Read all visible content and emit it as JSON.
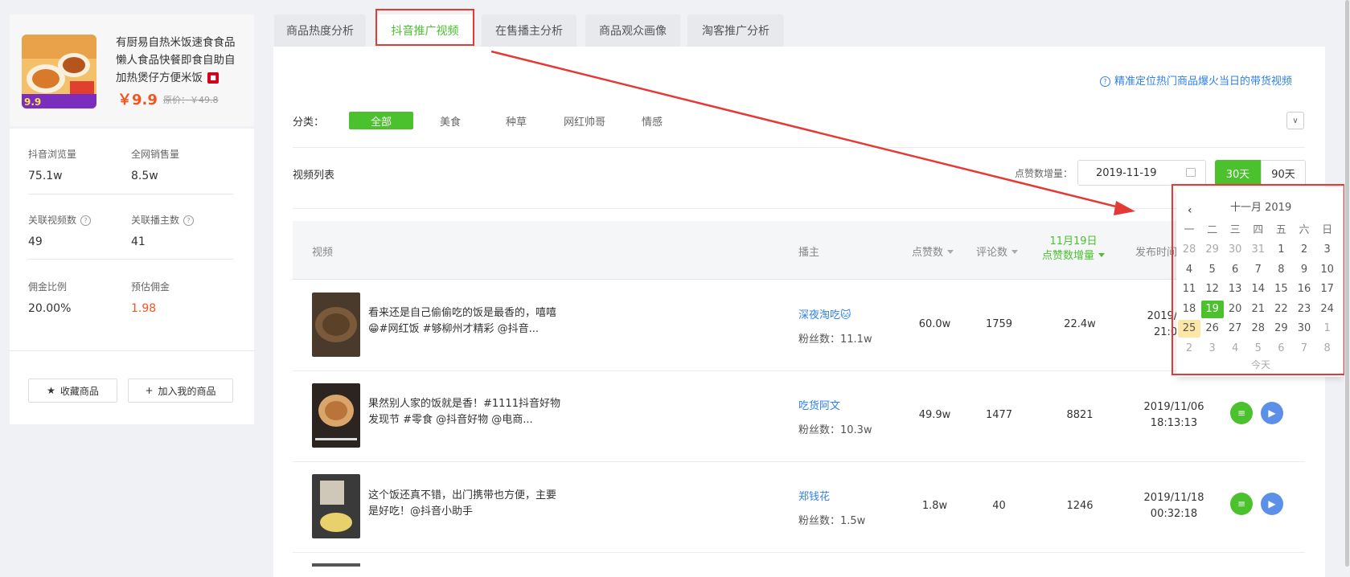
{
  "product": {
    "title": "有厨易自热米饭速食食品懒人食品快餐即食自助自加热煲仔方便米饭",
    "badge": "天猫",
    "price": "￥9.9",
    "orig_price": "原价：￥49.8"
  },
  "stats": [
    {
      "label": "抖音浏览量",
      "value": "75.1w",
      "help": false
    },
    {
      "label": "全网销售量",
      "value": "8.5w",
      "help": false
    },
    {
      "label": "关联视频数",
      "value": "49",
      "help": true
    },
    {
      "label": "关联播主数",
      "value": "41",
      "help": true
    },
    {
      "label": "佣金比例",
      "value": "20.00%",
      "help": false
    },
    {
      "label": "预估佣金",
      "value": "1.98",
      "help": false
    }
  ],
  "actions": {
    "favorite": "收藏商品",
    "add_mine": "加入我的商品"
  },
  "tabs": [
    "商品热度分析",
    "抖音推广视频",
    "在售播主分析",
    "商品观众画像",
    "淘客推广分析"
  ],
  "active_tab": 1,
  "hint_link": "精准定位热门商品爆火当日的带货视频",
  "category": {
    "label": "分类：",
    "items": [
      "全部",
      "美食",
      "种草",
      "网红帅哥",
      "情感"
    ],
    "active": 0
  },
  "list": {
    "title": "视频列表",
    "date_label": "点赞数增量：",
    "date_value": "2019-11-19",
    "ranges": [
      "30天",
      "90天"
    ]
  },
  "columns": {
    "video": "视频",
    "anchor": "播主",
    "likes": "点赞数",
    "comments": "评论数",
    "day_label": "11月19日",
    "day_sub": "点赞数增量",
    "publish": "发布时间"
  },
  "rows": [
    {
      "desc": "看来还是自己偷偷吃的饭是最香的，嘻嘻😁#网红饭 #够柳州才精彩 @抖音...",
      "anchor": "深夜淘吃🐱",
      "fans": "粉丝数：11.1w",
      "likes": "60.0w",
      "comments": "1759",
      "inc": "22.4w",
      "date": "2019/11/0",
      "time": "21:00:0"
    },
    {
      "desc": "果然别人家的饭就是香！#1111抖音好物发现节 #零食 @抖音好物 @电商...",
      "anchor": "吃货阿文",
      "fans": "粉丝数：10.3w",
      "likes": "49.9w",
      "comments": "1477",
      "inc": "8821",
      "date": "2019/11/06",
      "time": "18:13:13"
    },
    {
      "desc": "这个饭还真不错，出门携带也方便，主要是好吃！@抖音小助手",
      "anchor": "郑钱花",
      "fans": "粉丝数：1.5w",
      "likes": "1.8w",
      "comments": "40",
      "inc": "1246",
      "date": "2019/11/18",
      "time": "00:32:18"
    }
  ],
  "calendar": {
    "month": "十一月 2019",
    "weekdays": [
      "一",
      "二",
      "三",
      "四",
      "五",
      "六",
      "日"
    ],
    "days": [
      [
        "28",
        "29",
        "30",
        "31",
        "1",
        "2",
        "3"
      ],
      [
        "4",
        "5",
        "6",
        "7",
        "8",
        "9",
        "10"
      ],
      [
        "11",
        "12",
        "13",
        "14",
        "15",
        "16",
        "17"
      ],
      [
        "18",
        "19",
        "20",
        "21",
        "22",
        "23",
        "24"
      ],
      [
        "25",
        "26",
        "27",
        "28",
        "29",
        "30",
        "1"
      ],
      [
        "2",
        "3",
        "4",
        "5",
        "6",
        "7",
        "8"
      ]
    ],
    "selected": "19",
    "today_cell": "25",
    "today_label": "今天"
  },
  "colors": {
    "green": "#4cc12e",
    "red": "#e53935",
    "blue": "#2f80ed",
    "price": "#f5541e"
  }
}
